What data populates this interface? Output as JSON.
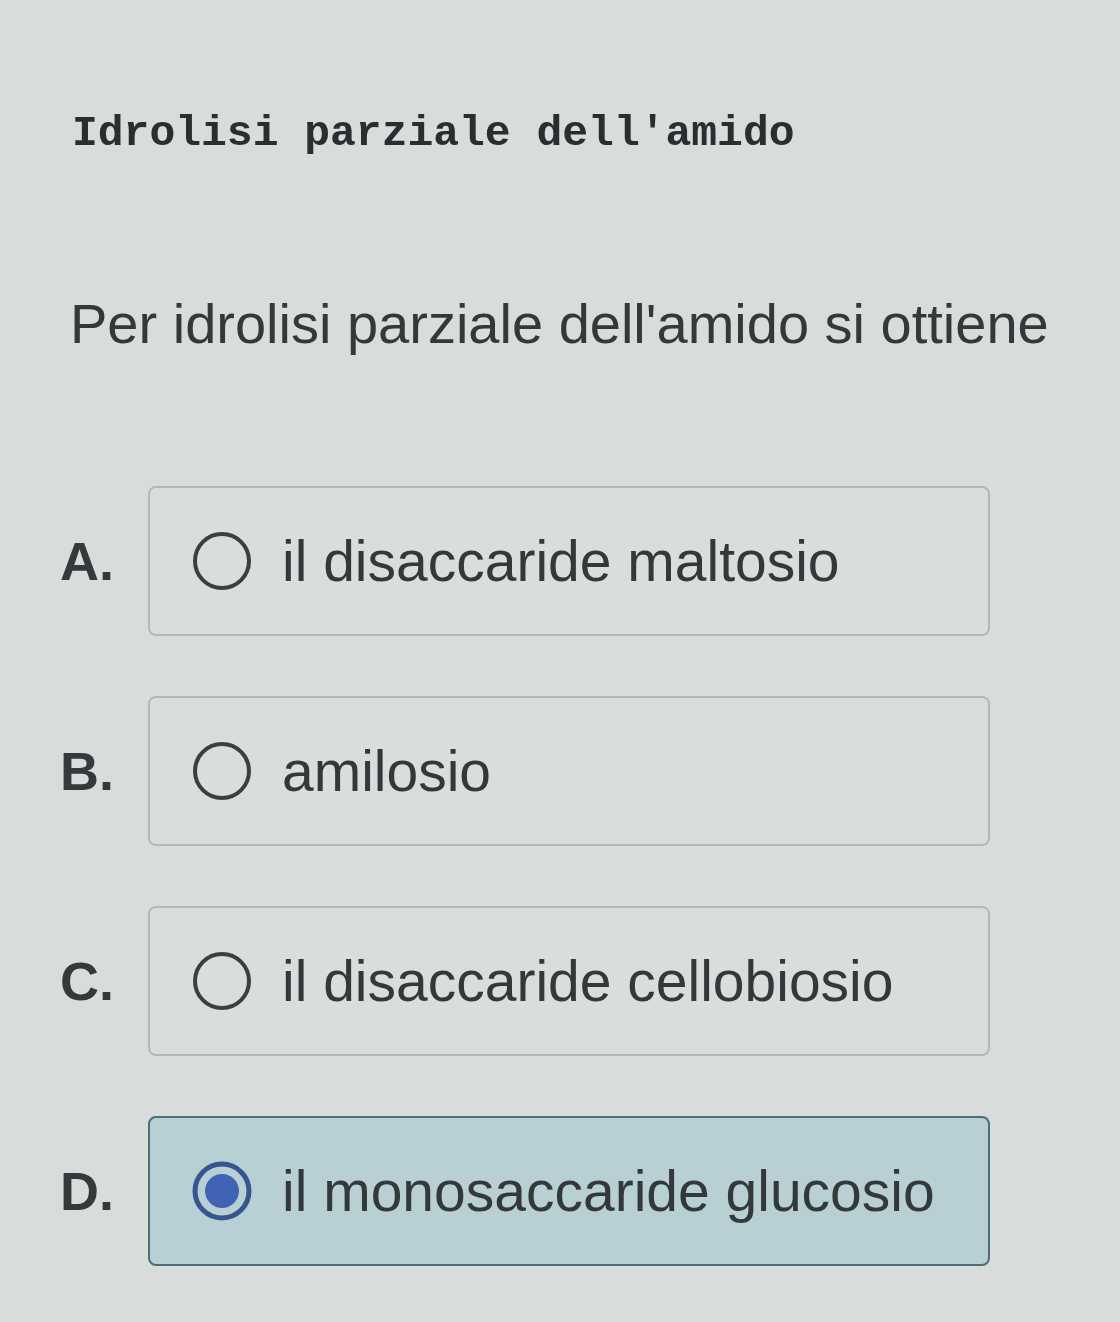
{
  "title": "Idrolisi parziale dell'amido",
  "question": "Per idrolisi parziale dell'amido si ottiene",
  "options": [
    {
      "letter": "A.",
      "text": "il disaccaride maltosio",
      "selected": false
    },
    {
      "letter": "B.",
      "text": "amilosio",
      "selected": false
    },
    {
      "letter": "C.",
      "text": "il disaccaride cellobiosio",
      "selected": false
    },
    {
      "letter": "D.",
      "text": "il monosaccaride glucosio",
      "selected": true
    }
  ]
}
